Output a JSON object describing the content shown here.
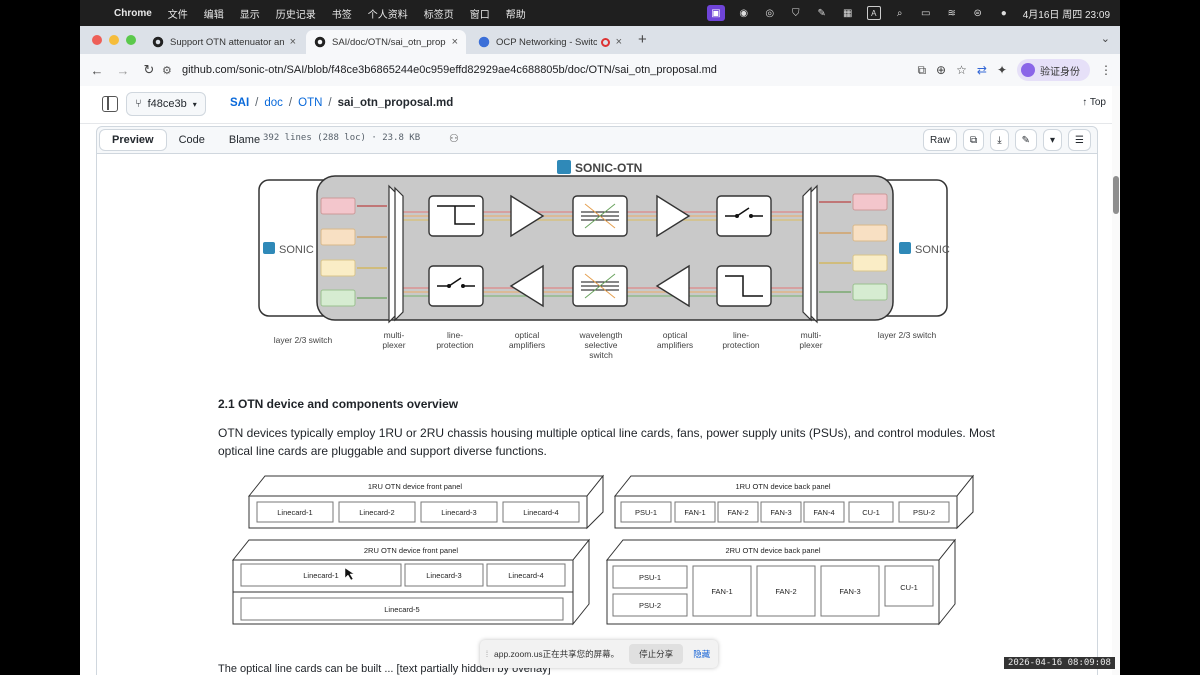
{
  "menubar": {
    "app": "Chrome",
    "items": [
      "文件",
      "编辑",
      "显示",
      "历史记录",
      "书签",
      "个人资料",
      "标签页",
      "窗口",
      "帮助"
    ],
    "clock": "4月16日 周四 23:09",
    "input_method": "A"
  },
  "tabs": [
    {
      "title": "Support OTN attenuator and",
      "icon": "github-icon"
    },
    {
      "title": "SAI/doc/OTN/sai_otn_propos",
      "icon": "github-icon"
    },
    {
      "title": "OCP Networking - Switch",
      "icon": "ocp-icon"
    }
  ],
  "url": "github.com/sonic-otn/SAI/blob/f48ce3b6865244e0c959effd82929ae4c688805b/doc/OTN/sai_otn_proposal.md",
  "profile_label": "验证身份",
  "repo": {
    "branch": "f48ce3b",
    "crumbs": [
      "SAI",
      "doc",
      "OTN"
    ],
    "file": "sai_otn_proposal.md",
    "top_label": "Top"
  },
  "filebar": {
    "tabs": [
      "Preview",
      "Code",
      "Blame"
    ],
    "meta": "392 lines (288 loc) · 23.8 KB",
    "raw": "Raw"
  },
  "diagram1": {
    "logo_text": "SONIC-OTN",
    "sonic_left": "SONIC",
    "sonic_right": "SONIC",
    "labels": {
      "l23_left": "layer 2/3 switch",
      "mux_left": [
        "multi-",
        "plexer"
      ],
      "lp_left": [
        "line-",
        "protection"
      ],
      "amp_left": [
        "optical",
        "amplifiers"
      ],
      "wss": [
        "wavelength",
        "selective",
        "switch"
      ],
      "amp_right": [
        "optical",
        "amplifiers"
      ],
      "lp_right": [
        "line-",
        "protection"
      ],
      "mux_right": [
        "multi-",
        "plexer"
      ],
      "l23_right": "layer 2/3 switch"
    },
    "colors": {
      "red": "#f3c6cc",
      "peach": "#f8e0c3",
      "yellow": "#faedc6",
      "green": "#d6ecd1",
      "chassis": "#c8c8c8"
    }
  },
  "section": {
    "heading": "2.1 OTN device and components overview",
    "para": "OTN devices typically employ 1RU or 2RU chassis housing multiple optical line cards, fans, power supply units (PSUs), and control modules. Most optical line cards are pluggable and support diverse functions.",
    "cutoff": "The optical line cards can be built ... [text partially hidden by overlay]"
  },
  "diagram2": {
    "front1": {
      "title": "1RU OTN device front panel",
      "slots": [
        "Linecard-1",
        "Linecard-2",
        "Linecard-3",
        "Linecard-4"
      ]
    },
    "back1": {
      "title": "1RU OTN device back panel",
      "slots": [
        "PSU-1",
        "FAN-1",
        "FAN-2",
        "FAN-3",
        "FAN-4",
        "CU-1",
        "PSU-2"
      ]
    },
    "front2": {
      "title": "2RU OTN device front panel",
      "slots": [
        "Linecard-1",
        "Linecard-3",
        "Linecard-4",
        "Linecard-5"
      ]
    },
    "back2": {
      "title": "2RU OTN device back panel",
      "slots": [
        "PSU-1",
        "PSU-2",
        "FAN-1",
        "FAN-2",
        "FAN-3",
        "CU-1"
      ]
    }
  },
  "zoom": {
    "message": "app.zoom.us正在共享您的屏幕。",
    "stop": "停止分享",
    "hide": "隐藏"
  },
  "recording_stamp": "2026-04-16 08:09:08"
}
